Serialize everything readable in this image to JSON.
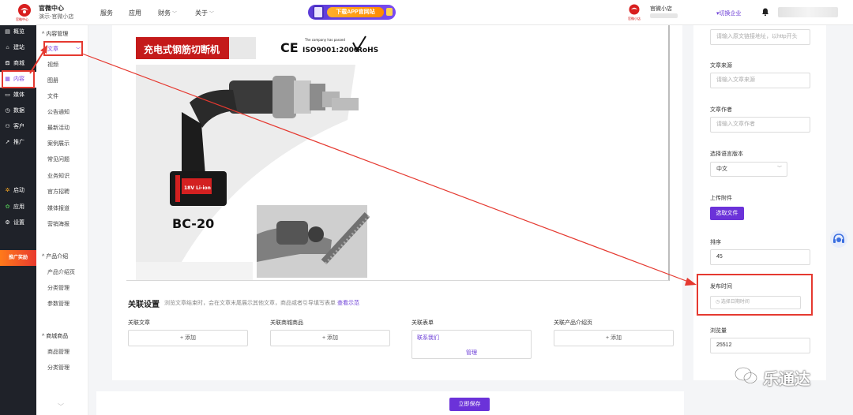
{
  "header": {
    "logo_caption": "官微中心",
    "brand_title": "官微中心",
    "brand_sub": "演示-官微小店",
    "nav": [
      {
        "label": "服务",
        "has_caret": false
      },
      {
        "label": "应用",
        "has_caret": false
      },
      {
        "label": "财务",
        "has_caret": true
      },
      {
        "label": "关于",
        "has_caret": true
      }
    ],
    "promo_label": "下载APP官网站",
    "store_logo_caption": "官微小店",
    "store_name": "官微小店",
    "switch_enterprise": "▾切换企业"
  },
  "sidebar": {
    "items": [
      {
        "icon": "▤",
        "label": "概览"
      },
      {
        "icon": "⌂",
        "label": "建站"
      },
      {
        "icon": "⛾",
        "label": "商城"
      },
      {
        "icon": "▦",
        "label": "内容"
      },
      {
        "icon": "▭",
        "label": "媒体"
      },
      {
        "icon": "◷",
        "label": "数据"
      },
      {
        "icon": "⚇",
        "label": "客户"
      },
      {
        "icon": "➚",
        "label": "推广"
      },
      {
        "icon": "✲",
        "label": "启动"
      },
      {
        "icon": "✿",
        "label": "应用"
      },
      {
        "icon": "⚙",
        "label": "设置"
      }
    ],
    "promo": "推广奖励"
  },
  "subsidebar": {
    "group1": "内容管理",
    "group1_items": [
      "文章",
      "视频",
      "图册",
      "文件",
      "公告通知",
      "最新活动",
      "案例展示",
      "常见问题",
      "业务知识",
      "官方招聘",
      "媒体报道",
      "营销海报"
    ],
    "group2": "产品介绍",
    "group2_items": [
      "产品介绍页",
      "分类管理",
      "参数管理"
    ],
    "group3": "商城商品",
    "group3_items": [
      "商品管理",
      "分类管理"
    ]
  },
  "product_image": {
    "banner_title": "充电式钢筋切断机",
    "cert_small": "The company has passed",
    "cert_text": "ISO9001:2000",
    "ce": "CE",
    "rohs": "RoHS",
    "model": "BC-20",
    "battery_label": "18V Li-ion"
  },
  "related": {
    "title": "关联设置",
    "desc": "浏览文章结束时，会在文章末尾展示其他文章，商品或者引导填写表单",
    "example_link": "查看示范",
    "columns": [
      {
        "label": "关联文章",
        "add": "+  添加"
      },
      {
        "label": "关联商城商品",
        "add": "+  添加"
      },
      {
        "label": "关联表单",
        "add": ""
      },
      {
        "label": "关联产品介绍页",
        "add": "+  添加"
      }
    ],
    "form_item": "联系我们",
    "form_manage": "管理"
  },
  "right_panel": {
    "url_placeholder": "请输入原文链接地址，以http开头",
    "source_label": "文章来源",
    "source_placeholder": "请输入文章来源",
    "author_label": "文章作者",
    "author_placeholder": "请输入文章作者",
    "lang_label": "选择语言版本",
    "lang_value": "中文",
    "attach_label": "上传附件",
    "attach_button": "选取文件",
    "sort_label": "排序",
    "sort_value": "45",
    "publish_label": "发布时间",
    "publish_placeholder": "◷  选择日期时间",
    "views_label": "浏览量",
    "views_value": "25512"
  },
  "footer": {
    "save_button": "立即保存"
  },
  "watermark": "乐通达",
  "colors": {
    "accent": "#6b32d9",
    "annotation": "#e53930",
    "sidebar_bg": "#1f2229"
  }
}
